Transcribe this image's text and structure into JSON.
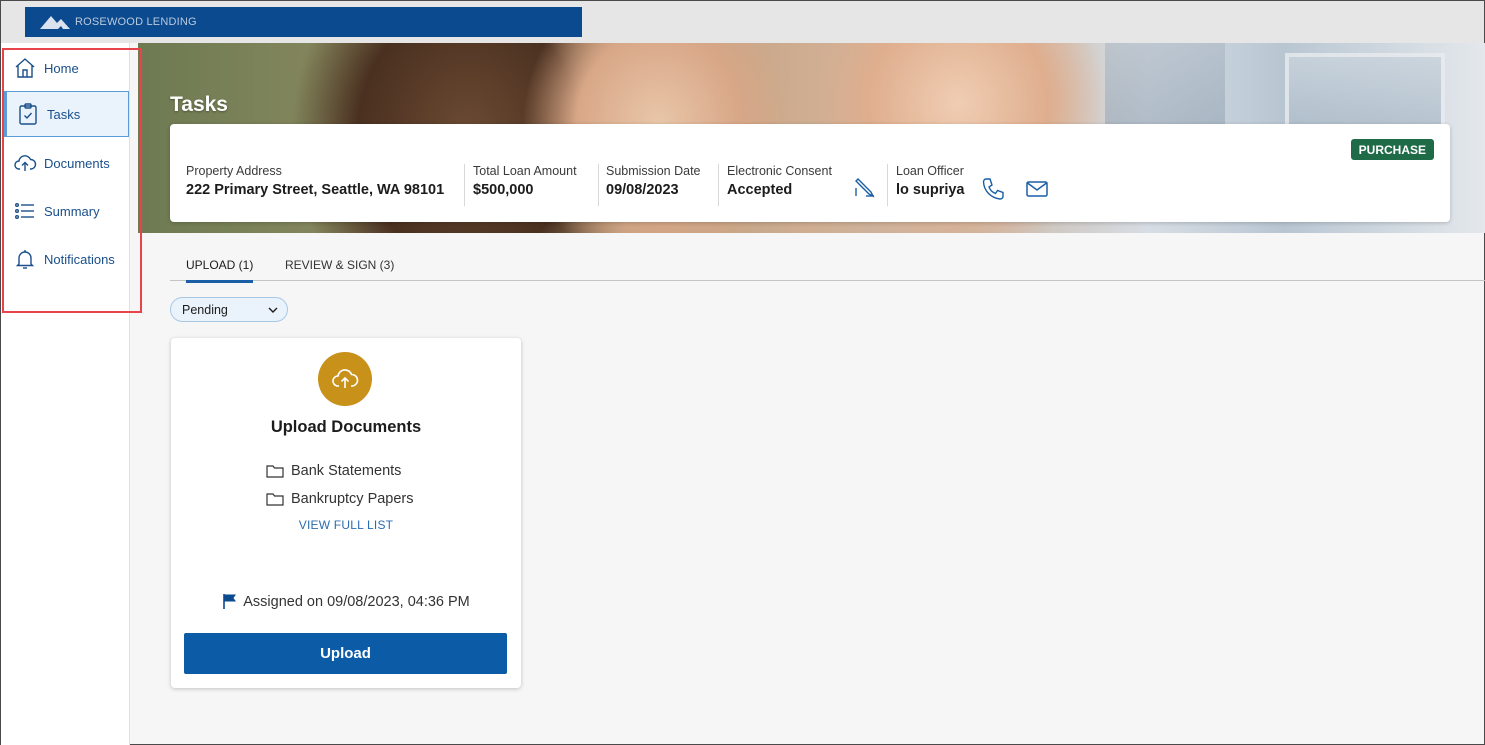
{
  "brand": {
    "name": "ROSEWOOD LENDING"
  },
  "sidebar": {
    "items": [
      {
        "label": "Home",
        "icon": "home-icon"
      },
      {
        "label": "Tasks",
        "icon": "clipboard-check-icon",
        "active": true
      },
      {
        "label": "Documents",
        "icon": "cloud-upload-icon"
      },
      {
        "label": "Summary",
        "icon": "list-icon"
      },
      {
        "label": "Notifications",
        "icon": "bell-icon"
      }
    ]
  },
  "page": {
    "title": "Tasks"
  },
  "loan": {
    "badge": "PURCHASE",
    "property_address_label": "Property Address",
    "property_address": "222 Primary Street, Seattle, WA 98101",
    "total_loan_amount_label": "Total Loan Amount",
    "total_loan_amount": "$500,000",
    "submission_date_label": "Submission Date",
    "submission_date": "09/08/2023",
    "electronic_consent_label": "Electronic Consent",
    "electronic_consent": "Accepted",
    "loan_officer_label": "Loan Officer",
    "loan_officer": "lo supriya"
  },
  "tabs": [
    {
      "label": "UPLOAD (1)",
      "active": true
    },
    {
      "label": "REVIEW & SIGN (3)",
      "active": false
    }
  ],
  "filter": {
    "selected": "Pending"
  },
  "task_card": {
    "title": "Upload Documents",
    "documents": [
      "Bank Statements",
      "Bankruptcy Papers"
    ],
    "view_full_list": "VIEW FULL LIST",
    "assigned": "Assigned on 09/08/2023, 04:36 PM",
    "button_label": "Upload"
  },
  "colors": {
    "brand_blue": "#0b4a8f",
    "accent_blue": "#0b5ba6",
    "badge_green": "#1f6b48",
    "upload_gold": "#c8911a",
    "highlight_red": "#e8424a"
  }
}
